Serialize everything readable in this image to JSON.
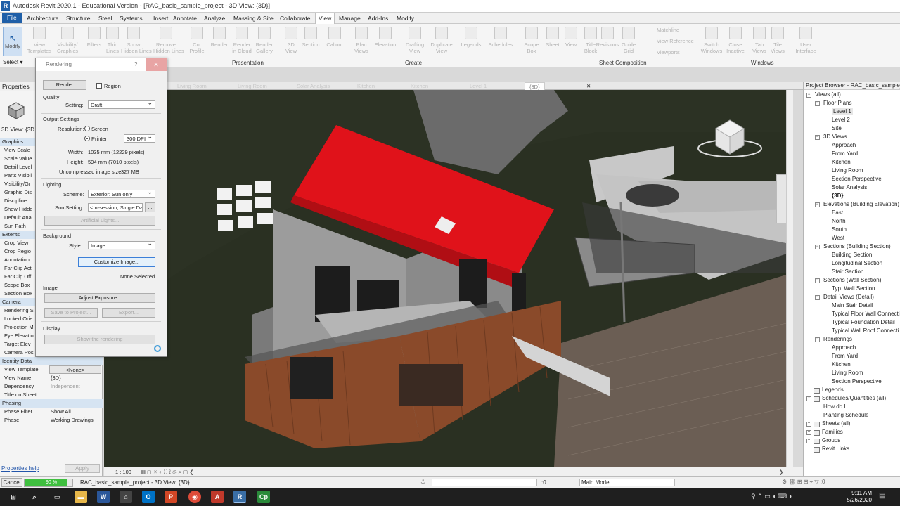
{
  "app": {
    "title": "Autodesk Revit 2020.1 - Educational Version - [RAC_basic_sample_project - 3D View: {3D}]",
    "logo": "R"
  },
  "menu": [
    "File",
    "Architecture",
    "Structure",
    "Steel",
    "Systems",
    "Insert",
    "Annotate",
    "Analyze",
    "Massing & Site",
    "Collaborate",
    "View",
    "Manage",
    "Add-Ins",
    "Modify"
  ],
  "ribbon": {
    "modify": "Modify",
    "select": "Select",
    "tools": [
      {
        "label": "View\nTemplates"
      },
      {
        "label": "Visibility/\nGraphics"
      },
      {
        "label": "Filters"
      },
      {
        "label": "Thin\nLines"
      },
      {
        "label": "Show\nHidden Lines"
      },
      {
        "label": "Remove\nHidden Lines"
      },
      {
        "label": "Cut\nProfile"
      },
      {
        "label": "Render"
      },
      {
        "label": "Render\nin Cloud"
      },
      {
        "label": "Render\nGallery"
      },
      {
        "label": "3D\nView"
      },
      {
        "label": "Section"
      },
      {
        "label": "Callout"
      },
      {
        "label": "Plan\nViews"
      },
      {
        "label": "Elevation"
      },
      {
        "label": "Drafting\nView"
      },
      {
        "label": "Duplicate\nView"
      },
      {
        "label": "Legends"
      },
      {
        "label": "Schedules"
      },
      {
        "label": "Scope\nBox"
      },
      {
        "label": "Sheet"
      },
      {
        "label": "View"
      },
      {
        "label": "Title\nBlock"
      },
      {
        "label": "Revisions"
      },
      {
        "label": "Guide\nGrid"
      },
      {
        "label": "Switch\nWindows"
      },
      {
        "label": "Close\nInactive"
      },
      {
        "label": "Tab\nViews"
      },
      {
        "label": "Tile\nViews"
      },
      {
        "label": "User\nInterface"
      }
    ],
    "small": [
      "Matchline",
      "View Reference",
      "Viewports"
    ],
    "panels": [
      "Presentation",
      "Create",
      "Sheet Composition",
      "Windows"
    ]
  },
  "properties": {
    "header": "Properties",
    "type_selector": "3D View: {3D",
    "rows": [
      {
        "k": "Graphics",
        "group": true
      },
      {
        "k": "View Scale"
      },
      {
        "k": "Scale Value"
      },
      {
        "k": "Detail Level"
      },
      {
        "k": "Parts Visibil"
      },
      {
        "k": "Visibility/Gr"
      },
      {
        "k": "Graphic Dis"
      },
      {
        "k": "Discipline"
      },
      {
        "k": "Show Hidde"
      },
      {
        "k": "Default Ana"
      },
      {
        "k": "Sun Path"
      },
      {
        "k": "Extents",
        "group": true
      },
      {
        "k": "Crop View"
      },
      {
        "k": "Crop Regio"
      },
      {
        "k": "Annotation"
      },
      {
        "k": "Far Clip Act"
      },
      {
        "k": "Far Clip Off"
      },
      {
        "k": "Scope Box"
      },
      {
        "k": "Section Box"
      },
      {
        "k": "Camera",
        "group": true
      },
      {
        "k": "Rendering S"
      },
      {
        "k": "Locked Orie"
      },
      {
        "k": "Projection M"
      },
      {
        "k": "Eye Elevatio"
      },
      {
        "k": "Target Elev"
      },
      {
        "k": "Camera Pos"
      },
      {
        "k": "Identity Data",
        "group": true
      },
      {
        "k": "View Template",
        "v": "<None>",
        "btn": true
      },
      {
        "k": "View Name",
        "v": "{3D}"
      },
      {
        "k": "Dependency",
        "v": "Independent"
      },
      {
        "k": "Title on Sheet",
        "v": ""
      },
      {
        "k": "Phasing",
        "group": true
      },
      {
        "k": "Phase Filter",
        "v": "Show All"
      },
      {
        "k": "Phase",
        "v": "Working Drawings"
      }
    ],
    "help": "Properties help",
    "apply": "Apply"
  },
  "tabs": [
    "Living Room",
    "Living Room",
    "Solar Analysis",
    "Kitchen",
    "Kitchen",
    "Level 1",
    "{3D}"
  ],
  "browser": {
    "header": "Project Browser - RAC_basic_sample_project",
    "items": [
      {
        "t": "Views (all)",
        "d": 0,
        "box": "−"
      },
      {
        "t": "Floor Plans",
        "d": 1,
        "box": "−"
      },
      {
        "t": "Level 1",
        "d": 2,
        "sel": true
      },
      {
        "t": "Level 2",
        "d": 2
      },
      {
        "t": "Site",
        "d": 2
      },
      {
        "t": "3D Views",
        "d": 1,
        "box": "−"
      },
      {
        "t": "Approach",
        "d": 2
      },
      {
        "t": "From Yard",
        "d": 2
      },
      {
        "t": "Kitchen",
        "d": 2
      },
      {
        "t": "Living Room",
        "d": 2
      },
      {
        "t": "Section Perspective",
        "d": 2
      },
      {
        "t": "Solar Analysis",
        "d": 2
      },
      {
        "t": "{3D}",
        "d": 2,
        "bold": true
      },
      {
        "t": "Elevations (Building Elevation)",
        "d": 1,
        "box": "−"
      },
      {
        "t": "East",
        "d": 2
      },
      {
        "t": "North",
        "d": 2
      },
      {
        "t": "South",
        "d": 2
      },
      {
        "t": "West",
        "d": 2
      },
      {
        "t": "Sections (Building Section)",
        "d": 1,
        "box": "−"
      },
      {
        "t": "Building Section",
        "d": 2
      },
      {
        "t": "Longitudinal Section",
        "d": 2
      },
      {
        "t": "Stair Section",
        "d": 2
      },
      {
        "t": "Sections (Wall Section)",
        "d": 1,
        "box": "−"
      },
      {
        "t": "Typ. Wall Section",
        "d": 2
      },
      {
        "t": "Detail Views (Detail)",
        "d": 1,
        "box": "−"
      },
      {
        "t": "Main Stair Detail",
        "d": 2
      },
      {
        "t": "Typical Floor Wall Connecti",
        "d": 2
      },
      {
        "t": "Typical Foundation Detail",
        "d": 2
      },
      {
        "t": "Typical Wall Roof Connecti",
        "d": 2
      },
      {
        "t": "Renderings",
        "d": 1,
        "box": "−"
      },
      {
        "t": "Approach",
        "d": 2
      },
      {
        "t": "From Yard",
        "d": 2
      },
      {
        "t": "Kitchen",
        "d": 2
      },
      {
        "t": "Living Room",
        "d": 2
      },
      {
        "t": "Section Perspective",
        "d": 2
      },
      {
        "t": "Legends",
        "d": 0,
        "icon": true
      },
      {
        "t": "Schedules/Quantities (all)",
        "d": 0,
        "box": "−",
        "icon": true
      },
      {
        "t": "How do I",
        "d": 1
      },
      {
        "t": "Planting Schedule",
        "d": 1
      },
      {
        "t": "Sheets (all)",
        "d": 0,
        "box": "+",
        "icon": true
      },
      {
        "t": "Families",
        "d": 0,
        "box": "+",
        "icon": true
      },
      {
        "t": "Groups",
        "d": 0,
        "box": "+",
        "icon": true
      },
      {
        "t": "Revit Links",
        "d": 0,
        "icon": true
      }
    ]
  },
  "dialog": {
    "title": "Rendering",
    "help": "?",
    "render": "Render",
    "region": "Region",
    "quality": "Quality",
    "setting_label": "Setting:",
    "setting_value": "Draft",
    "output": "Output Settings",
    "resolution_label": "Resolution:",
    "screen": "Screen",
    "printer": "Printer",
    "dpi": "300 DPI",
    "width_label": "Width:",
    "width_value": "1035 mm (12229 pixels)",
    "height_label": "Height:",
    "height_value": "594 mm (7010 pixels)",
    "size_label": "Uncompressed image size:",
    "size_value": "327 MB",
    "lighting": "Lighting",
    "scheme_label": "Scheme:",
    "scheme_value": "Exterior: Sun only",
    "sun_label": "Sun Setting:",
    "sun_value": "<In-session, Single Da",
    "sun_more": "...",
    "artificial": "Artificial Lights...",
    "background": "Background",
    "style_label": "Style:",
    "style_value": "Image",
    "customize": "Customize Image...",
    "none_selected": "None Selected",
    "image": "Image",
    "adjust": "Adjust Exposure...",
    "save": "Save to Project...",
    "export": "Export...",
    "display": "Display",
    "show": "Show the rendering"
  },
  "viewbar": {
    "scale": "1 : 100"
  },
  "status": {
    "cancel": "Cancel",
    "progress_text": "90 %",
    "progress": 0.9,
    "doc": "RAC_basic_sample_project - 3D View: {3D}",
    "zero": ":0",
    "model": "Main Model"
  },
  "taskbar": {
    "time": "9:11 AM",
    "date": "5/26/2020"
  },
  "colors": {
    "accent": "#1f5fa8",
    "roof": "#e0121a",
    "cladding": "#8a4a2a",
    "progress": "#3fbf3f"
  }
}
